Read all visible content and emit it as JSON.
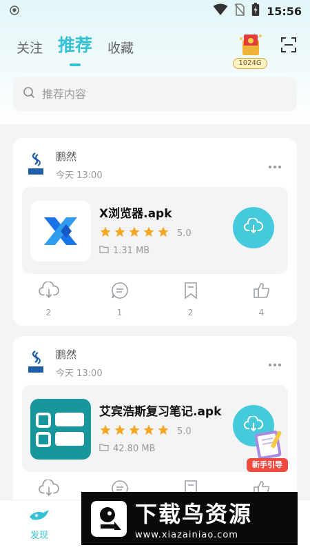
{
  "status_bar": {
    "time": "15:56"
  },
  "tabs": [
    {
      "label": "关注"
    },
    {
      "label": "推荐",
      "active": true
    },
    {
      "label": "收藏"
    }
  ],
  "gift": {
    "badge": "1024G"
  },
  "search": {
    "placeholder": "推荐内容"
  },
  "posts": [
    {
      "author": "鹏然",
      "time": "今天 13:00",
      "app": {
        "name": "X浏览器.apk",
        "rating": "5.0",
        "size": "1.31 MB",
        "stars": 5
      },
      "actions": {
        "download": "2",
        "comment": "1",
        "bookmark": "2",
        "like": "4"
      }
    },
    {
      "author": "鹏然",
      "time": "今天 13:00",
      "app": {
        "name": "艾宾浩斯复习笔记.apk",
        "rating": "5.0",
        "size": "42.80 MB",
        "stars": 5
      }
    }
  ],
  "bottom_nav": {
    "discover": "发现"
  },
  "guide": {
    "label": "新手引导"
  },
  "watermark": {
    "title": "下载鸟资源",
    "url": "www.xiazainiao.com"
  },
  "colors": {
    "accent": "#35c2d6",
    "download_button": "#45cadb",
    "star": "#f5a623"
  }
}
